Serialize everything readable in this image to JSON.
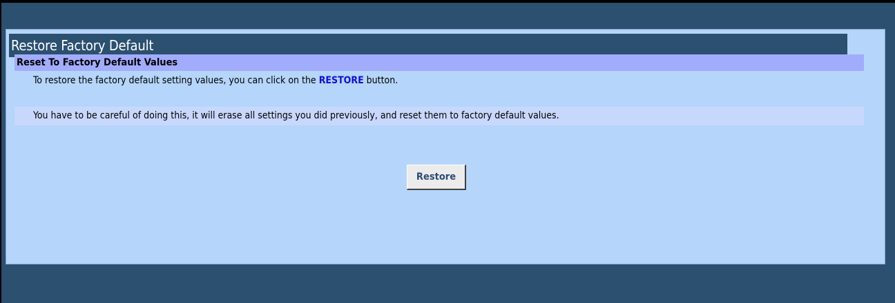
{
  "page": {
    "title": "Restore Factory Default"
  },
  "section": {
    "heading": "Reset To Factory Default Values",
    "line1_before": "To restore the factory default setting values, you can click on the ",
    "line1_keyword": "RESTORE",
    "line1_after": " button.",
    "line2": "You have to be careful of doing this, it will erase all settings you did previously, and reset them to factory default values."
  },
  "actions": {
    "restore_label": "Restore"
  },
  "colors": {
    "frame": "#2b5070",
    "panel": "#b5d5fa",
    "section_head": "#a2acfc",
    "alt_row": "#c8d8fc",
    "keyword": "#1010e0",
    "button_text": "#2b4c75"
  }
}
